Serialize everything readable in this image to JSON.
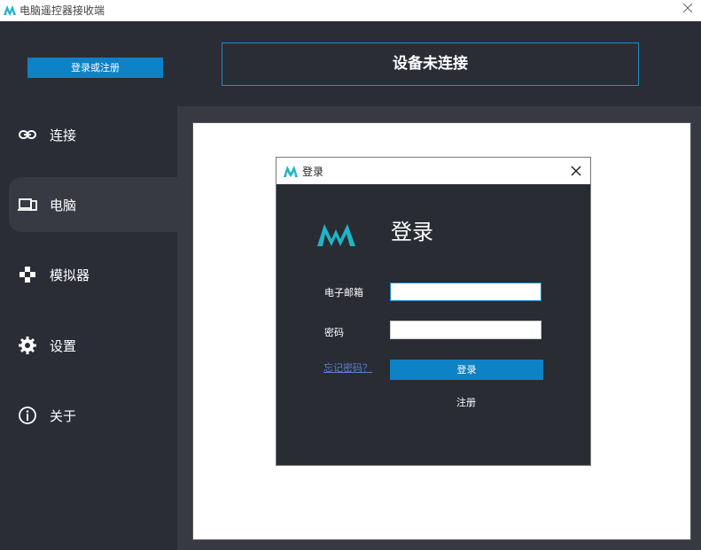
{
  "window": {
    "title": "电脑遥控器接收端",
    "logo_icon": "app-logo-icon",
    "close_icon": "close-icon"
  },
  "sidebar": {
    "login_register_label": "登录或注册",
    "items": [
      {
        "label": "连接",
        "icon": "link-icon"
      },
      {
        "label": "电脑",
        "icon": "computer-icon",
        "active": true
      },
      {
        "label": "模拟器",
        "icon": "gamepad-icon"
      },
      {
        "label": "设置",
        "icon": "gear-icon"
      },
      {
        "label": "关于",
        "icon": "info-icon"
      }
    ]
  },
  "status": {
    "text": "设备未连接"
  },
  "login_dialog": {
    "title": "登录",
    "heading": "登录",
    "email_label": "电子邮箱",
    "email_value": "",
    "password_label": "密码",
    "password_value": "",
    "forgot_label": "忘记密码？",
    "login_button_label": "登录",
    "register_label": "注册"
  },
  "colors": {
    "accent": "#0d82c6",
    "sidebar_bg": "#2a2d35",
    "active_bg": "#373a43",
    "logo_cyan": "#1fb5c8"
  }
}
